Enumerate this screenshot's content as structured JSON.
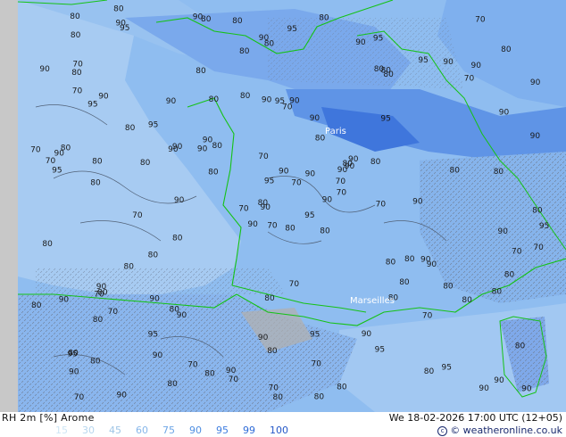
{
  "footer": {
    "title": "RH 2m [%] Arome",
    "datetime": "We 18-02-2026 17:00 UTC (12+05)",
    "credit": "© weatheronline.co.uk",
    "legend": [
      {
        "label": "15",
        "color": "#cfe6f5"
      },
      {
        "label": "30",
        "color": "#b7d6ee"
      },
      {
        "label": "45",
        "color": "#9fc5e6"
      },
      {
        "label": "60",
        "color": "#87b7ea"
      },
      {
        "label": "75",
        "color": "#6ea6e6"
      },
      {
        "label": "90",
        "color": "#4f8fe2"
      },
      {
        "label": "95",
        "color": "#3f7ee0"
      },
      {
        "label": "99",
        "color": "#2f6cd8"
      },
      {
        "label": "100",
        "color": "#2458c8"
      }
    ]
  },
  "map": {
    "cities": [
      "Paris",
      "Marseilles"
    ],
    "value_labels": [
      "80",
      "95",
      "90",
      "80",
      "90",
      "90",
      "95",
      "90",
      "80",
      "90",
      "95",
      "90",
      "80",
      "90",
      "90",
      "95",
      "90",
      "90",
      "80",
      "70",
      "80",
      "90",
      "90",
      "95",
      "90",
      "90",
      "90",
      "80",
      "95",
      "80",
      "90",
      "80",
      "90",
      "95",
      "90",
      "95",
      "80",
      "90",
      "80",
      "90",
      "80",
      "90",
      "80",
      "80",
      "80",
      "70",
      "70",
      "70",
      "80",
      "70",
      "80",
      "90",
      "90",
      "80",
      "95",
      "95",
      "90",
      "80",
      "95",
      "90",
      "95",
      "90",
      "80",
      "95",
      "90",
      "80",
      "90",
      "80",
      "90",
      "80",
      "80",
      "80",
      "80",
      "90",
      "95",
      "80",
      "80",
      "80",
      "70",
      "70",
      "90",
      "80",
      "70",
      "80",
      "70",
      "80",
      "70",
      "95",
      "80",
      "90",
      "90",
      "95",
      "80",
      "70",
      "70",
      "80",
      "90",
      "80",
      "80",
      "80",
      "70",
      "90",
      "80",
      "70",
      "80",
      "90",
      "70",
      "80",
      "70",
      "80",
      "90",
      "80",
      "70",
      "70",
      "80",
      "90",
      "70",
      "80",
      "80",
      "80",
      "70",
      "70",
      "90",
      "80",
      "90",
      "80",
      "90",
      "70",
      "80",
      "70",
      "80",
      "80",
      "90",
      "80",
      "70",
      "80",
      "80",
      "90",
      "70",
      "90",
      "80",
      "80",
      "80",
      "95",
      "90",
      "70",
      "90",
      "80"
    ]
  }
}
